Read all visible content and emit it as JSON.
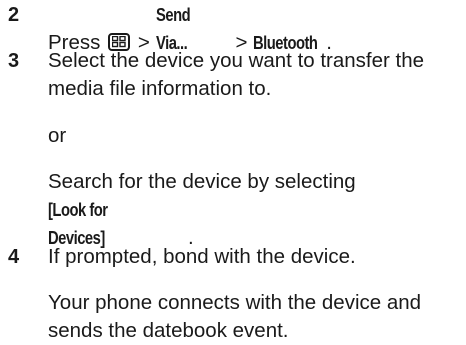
{
  "steps": [
    {
      "number": "2",
      "press": "Press",
      "menu_key_icon": "menu-key-icon",
      "sep1": ">",
      "send_via": "Send Via...",
      "sep2": ">",
      "bluetooth": "Bluetooth",
      "end": "."
    },
    {
      "number": "3",
      "line1": "Select the device you want to transfer the",
      "line2": "media file information to.",
      "or": "or",
      "search_line": "Search for the device by selecting",
      "look_for_devices": "[Look for Devices]",
      "end": "."
    },
    {
      "number": "4",
      "line1": "If prompted, bond with the device.",
      "result_line1": "Your phone connects with the device and",
      "result_line2": "sends the datebook event."
    }
  ]
}
